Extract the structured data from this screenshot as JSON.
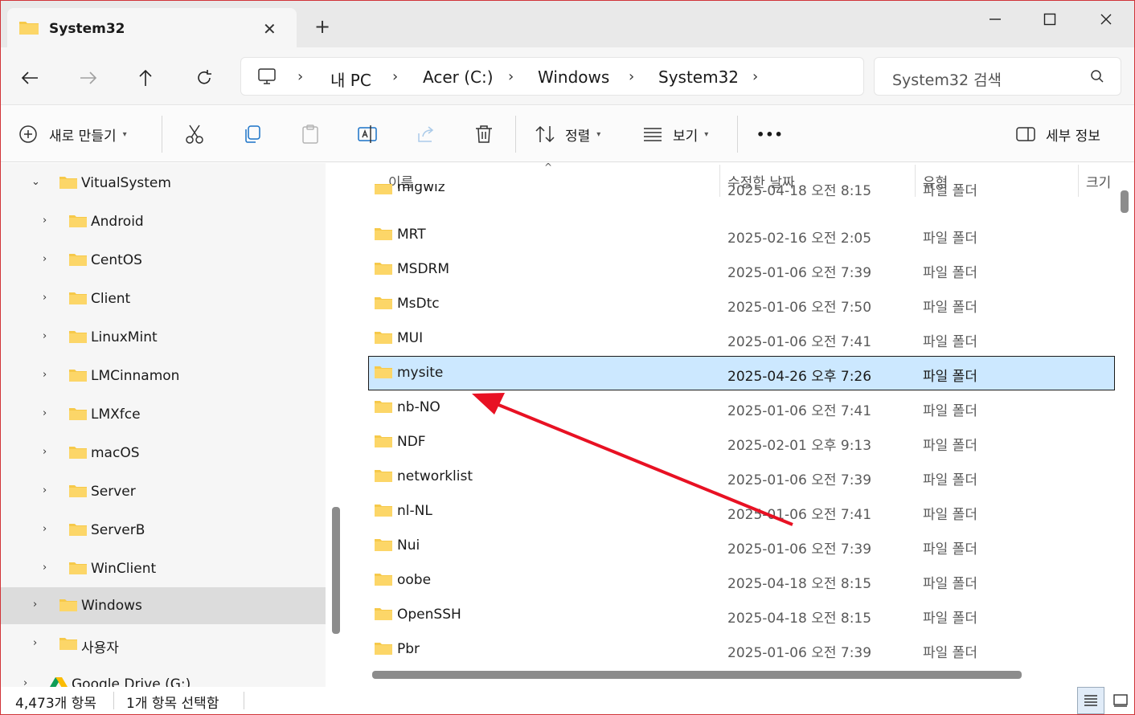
{
  "tab": {
    "title": "System32",
    "close": "✕"
  },
  "window": {
    "new_tab": "+"
  },
  "address": {
    "crumbs": [
      "내 PC",
      "Acer (C:)",
      "Windows",
      "System32"
    ]
  },
  "search": {
    "placeholder": "System32 검색"
  },
  "toolbar": {
    "new_label": "새로 만들기",
    "sort_label": "정렬",
    "view_label": "보기",
    "more_label": "•••",
    "details_label": "세부 정보"
  },
  "sidebar": {
    "items": [
      {
        "label": "VitualSystem",
        "expanded": true
      },
      {
        "label": "Android"
      },
      {
        "label": "CentOS"
      },
      {
        "label": "Client"
      },
      {
        "label": "LinuxMint"
      },
      {
        "label": "LMCinnamon"
      },
      {
        "label": "LMXfce"
      },
      {
        "label": "macOS"
      },
      {
        "label": "Server"
      },
      {
        "label": "ServerB"
      },
      {
        "label": "WinClient"
      },
      {
        "label": "Windows",
        "selected": true
      },
      {
        "label": "사용자"
      },
      {
        "label": "Google Drive (G:)"
      }
    ]
  },
  "filelist": {
    "columns": {
      "name": "이름",
      "date": "수정한 날짜",
      "type": "유형",
      "size": "크기"
    },
    "rows": [
      {
        "name": "migwiz",
        "date": "2025-04-18 오전 8:15",
        "type": "파일 폴더"
      },
      {
        "name": "MRT",
        "date": "2025-02-16 오전 2:05",
        "type": "파일 폴더"
      },
      {
        "name": "MSDRM",
        "date": "2025-01-06 오전 7:39",
        "type": "파일 폴더"
      },
      {
        "name": "MsDtc",
        "date": "2025-01-06 오전 7:50",
        "type": "파일 폴더"
      },
      {
        "name": "MUI",
        "date": "2025-01-06 오전 7:41",
        "type": "파일 폴더"
      },
      {
        "name": "mysite",
        "date": "2025-04-26 오후 7:26",
        "type": "파일 폴더",
        "selected": true
      },
      {
        "name": "nb-NO",
        "date": "2025-01-06 오전 7:41",
        "type": "파일 폴더"
      },
      {
        "name": "NDF",
        "date": "2025-02-01 오후 9:13",
        "type": "파일 폴더"
      },
      {
        "name": "networklist",
        "date": "2025-01-06 오전 7:39",
        "type": "파일 폴더"
      },
      {
        "name": "nl-NL",
        "date": "2025-01-06 오전 7:41",
        "type": "파일 폴더"
      },
      {
        "name": "Nui",
        "date": "2025-01-06 오전 7:39",
        "type": "파일 폴더"
      },
      {
        "name": "oobe",
        "date": "2025-04-18 오전 8:15",
        "type": "파일 폴더"
      },
      {
        "name": "OpenSSH",
        "date": "2025-04-18 오전 8:15",
        "type": "파일 폴더"
      },
      {
        "name": "Pbr",
        "date": "2025-01-06 오전 7:39",
        "type": "파일 폴더"
      }
    ]
  },
  "status": {
    "count": "4,473개 항목",
    "selected": "1개 항목 선택함"
  },
  "colors": {
    "accent_selection": "#cce8ff",
    "folder": "#f6c94a",
    "annotation_arrow": "#e81123"
  }
}
